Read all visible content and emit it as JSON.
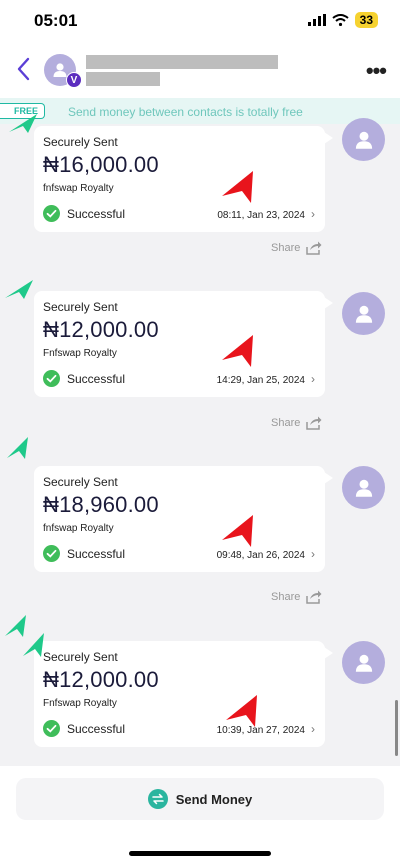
{
  "status_bar": {
    "time": "05:01",
    "battery": "33"
  },
  "header": {
    "verified_badge": "V"
  },
  "banner": {
    "tag": "FREE",
    "text": "Send money between contacts is totally free"
  },
  "transactions": [
    {
      "label": "Securely Sent",
      "amount": "₦16,000.00",
      "recipient": "fnfswap Royalty",
      "status": "Successful",
      "datetime": "08:11, Jan 23, 2024",
      "share": "Share"
    },
    {
      "label": "Securely Sent",
      "amount": "₦12,000.00",
      "recipient": "Fnfswap Royalty",
      "status": "Successful",
      "datetime": "14:29, Jan 25, 2024",
      "share": "Share"
    },
    {
      "label": "Securely Sent",
      "amount": "₦18,960.00",
      "recipient": "fnfswap Royalty",
      "status": "Successful",
      "datetime": "09:48, Jan 26, 2024",
      "share": "Share"
    },
    {
      "label": "Securely Sent",
      "amount": "₦12,000.00",
      "recipient": "Fnfswap Royalty",
      "status": "Successful",
      "datetime": "10:39, Jan 27, 2024"
    }
  ],
  "footer": {
    "send_label": "Send Money"
  },
  "colors": {
    "accent": "#1fb9a3",
    "avatar": "#b4aedd",
    "success": "#3fbd5a",
    "annotation_green": "#1fc98a",
    "annotation_red": "#e8141c"
  }
}
